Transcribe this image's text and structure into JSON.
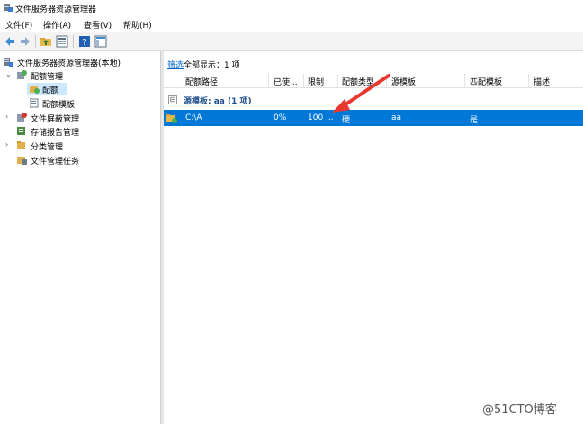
{
  "window": {
    "title": "文件服务器资源管理器"
  },
  "menu": [
    "文件(F)",
    "操作(A)",
    "查看(V)",
    "帮助(H)"
  ],
  "toolbar": {
    "buttons": [
      "back-arrow-icon",
      "forward-arrow-icon",
      "folder-up-icon",
      "properties-icon",
      "help-icon",
      "show-hide-icon"
    ]
  },
  "tree": {
    "root": "文件服务器资源管理器(本地)",
    "quota_management": "配额管理",
    "quotas": "配额",
    "quota_templates": "配额模板",
    "file_screening": "文件屏蔽管理",
    "storage_reports": "存储报告管理",
    "classification": "分类管理",
    "file_tasks": "文件管理任务"
  },
  "list": {
    "filter_link": "筛选",
    "filter_text": "全部显示：1 项",
    "columns": [
      "配额路径",
      "已使...",
      "限制",
      "配额类型",
      "源模板",
      "匹配模板",
      "描述"
    ],
    "group": {
      "toggle": "⊟",
      "label": "源模板: aa (1 项)"
    },
    "rows": [
      {
        "path": "C:\\A",
        "used": "0%",
        "limit": "100 ...",
        "type": "硬",
        "source": "aa",
        "match": "是",
        "description": ""
      }
    ]
  },
  "annotation": {
    "color": "#e8382f"
  },
  "watermark": "@51CTO博客"
}
